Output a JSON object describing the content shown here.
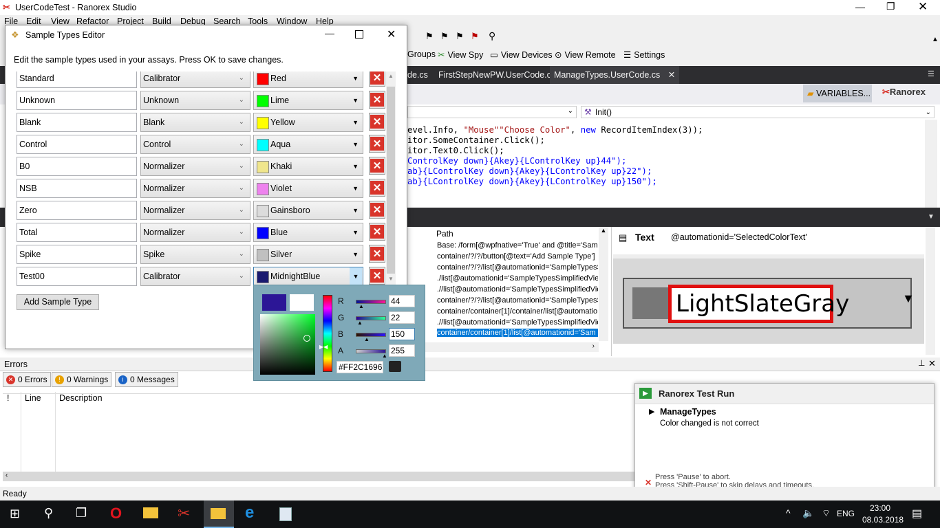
{
  "app": {
    "title": "UserCodeTest - Ranorex Studio"
  },
  "menu": [
    "File",
    "Edit",
    "View",
    "Refactor",
    "Project",
    "Build",
    "Debug",
    "Search",
    "Tools",
    "Window",
    "Help"
  ],
  "toolbar": {
    "groups_label": "Groups",
    "view_spy_label": "View Spy",
    "view_devices_label": "View Devices",
    "view_remote_label": "View Remote",
    "settings_label": "Settings"
  },
  "tabs": [
    {
      "label": "de.cs"
    },
    {
      "label": "FirstStepNewPW.UserCode.cs"
    },
    {
      "label": "ManageTypes.UserCode.cs"
    }
  ],
  "editor_header": {
    "variables_label": "VARIABLES...",
    "brand": "Ranorex",
    "method_combo": "Init()"
  },
  "code": [
    {
      "a": "evel.Info, ",
      "s1": "\"Mouse\"",
      ", ": ", ",
      "s2": "\"Choose Color\"",
      "b": ", ",
      "kw": "new",
      "c": " RecordItemIndex(3));"
    },
    {
      "line": "itor.SomeContainer.Click();"
    },
    {
      "line": "itor.Text0.Click();"
    },
    {
      "line": "ControlKey down}{Akey}{LControlKey up}44\");"
    },
    {
      "line": "ab}{LControlKey down}{Akey}{LControlKey up}22\");"
    },
    {
      "line": "ab}{LControlKey down}{Akey}{LControlKey up}150\");"
    }
  ],
  "paths_panel": {
    "header": "Path",
    "rows": [
      "Base: /form[@wpfnative='True' and @title='Sam",
      "container/?/?/button[@text='Add Sample Type']",
      "container/?/?/list[@automationid='SampleTypesS",
      "./list[@automationid='SampleTypesSimplifiedVie",
      ".//list[@automationid='SampleTypesSimplifiedVie",
      "container/?/?/list[@automationid='SampleTypesS",
      "container/container[1]/container/list[@automatio",
      ".//list[@automationid='SampleTypesSimplifiedVie",
      "container/container[1]/list[@automationid='Sam"
    ]
  },
  "preview": {
    "kind": "Text",
    "xpath": "@automationid='SelectedColorText'",
    "image_text": "LightSlateGray"
  },
  "dialog": {
    "title": "Sample Types Editor",
    "description": "Edit the sample types used in your assays. Press OK to save changes.",
    "rows": [
      {
        "name": "Standard",
        "type": "Calibrator",
        "color": "Red",
        "hex": "#ff0000"
      },
      {
        "name": "Unknown",
        "type": "Unknown",
        "color": "Lime",
        "hex": "#00ff00"
      },
      {
        "name": "Blank",
        "type": "Blank",
        "color": "Yellow",
        "hex": "#ffff00"
      },
      {
        "name": "Control",
        "type": "Control",
        "color": "Aqua",
        "hex": "#00ffff"
      },
      {
        "name": "B0",
        "type": "Normalizer",
        "color": "Khaki",
        "hex": "#f0e68c"
      },
      {
        "name": "NSB",
        "type": "Normalizer",
        "color": "Violet",
        "hex": "#ee82ee"
      },
      {
        "name": "Zero",
        "type": "Normalizer",
        "color": "Gainsboro",
        "hex": "#dcdcdc"
      },
      {
        "name": "Total",
        "type": "Normalizer",
        "color": "Blue",
        "hex": "#0000ff"
      },
      {
        "name": "Spike",
        "type": "Spike",
        "color": "Silver",
        "hex": "#c0c0c0"
      },
      {
        "name": "Test00",
        "type": "Calibrator",
        "color": "MidnightBlue",
        "hex": "#191970"
      }
    ],
    "add_button": "Add Sample Type"
  },
  "picker": {
    "r_label": "R",
    "g_label": "G",
    "b_label": "B",
    "a_label": "A",
    "r": "44",
    "g": "22",
    "b": "150",
    "a": "255",
    "hex": "#FF2C1696"
  },
  "errors": {
    "title": "Errors",
    "errors_btn": "0 Errors",
    "warnings_btn": "0 Warnings",
    "messages_btn": "0 Messages",
    "col_bang": "!",
    "col_line": "Line",
    "col_desc": "Description"
  },
  "testrun": {
    "title": "Ranorex Test Run",
    "item": "ManageTypes",
    "message": "Color changed is not correct",
    "hint1": "Press 'Pause' to abort.",
    "hint2": "Press 'Shift-Pause' to skip delays and timeouts."
  },
  "status": {
    "text": "Ready"
  },
  "tray": {
    "lang": "ENG",
    "time": "23:00",
    "date": "08.03.2018"
  }
}
